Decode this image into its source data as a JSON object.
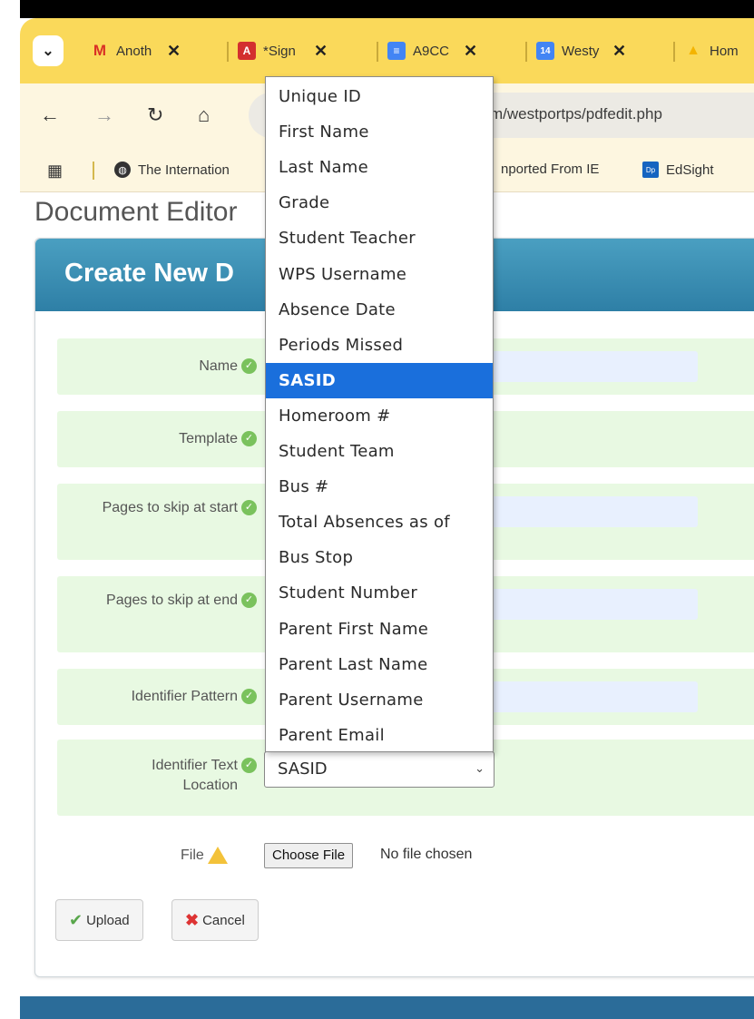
{
  "browser": {
    "tabs": [
      {
        "label": "Anoth",
        "icon": "gmail-icon",
        "icon_color": "#d93025",
        "glyph": "M"
      },
      {
        "label": "*Sign",
        "icon": "pdf-icon",
        "icon_color": "#d32f2f",
        "glyph": "A"
      },
      {
        "label": "A9CC",
        "icon": "docs-icon",
        "icon_color": "#4285f4",
        "glyph": "≡"
      },
      {
        "label": "Westy",
        "icon": "calendar-icon",
        "icon_color": "#4285f4",
        "glyph": "14"
      },
      {
        "label": "Hom",
        "icon": "drive-icon",
        "icon_color": "#f4b400",
        "glyph": "▲"
      }
    ],
    "tab_close": "✕",
    "url": "com/westportps/pdfedit.php",
    "bookmarks": [
      "The Internation",
      "nported From IE",
      "EdSight"
    ]
  },
  "page": {
    "doc_title": "Document Editor",
    "panel_title": "Create New D",
    "fields": {
      "name": "Name",
      "template": "Template",
      "skip_start": "Pages to skip at start",
      "skip_end": "Pages to skip at end",
      "identifier_pattern": "Identifier Pattern",
      "identifier_location": "Identifier Text Location",
      "file": "File"
    },
    "choose_file": "Choose File",
    "no_file": "No file chosen",
    "upload": "Upload",
    "cancel": "Cancel"
  },
  "dropdown": {
    "options": [
      "Unique ID",
      "First Name",
      "Last Name",
      "Grade",
      "Student Teacher",
      "WPS Username",
      "Absence Date",
      "Periods Missed",
      "SASID",
      "Homeroom #",
      "Student Team",
      "Bus #",
      "Total Absences as of",
      "Bus Stop",
      "Student Number",
      "Parent First Name",
      "Parent Last Name",
      "Parent Username",
      "Parent Email"
    ],
    "selected": "SASID",
    "selected_index": 8
  },
  "colors": {
    "tab_strip": "#fad95a",
    "panel_header": "#3a8db5",
    "row_bg": "#e8f9e2",
    "selected_option": "#1a6fdc"
  }
}
